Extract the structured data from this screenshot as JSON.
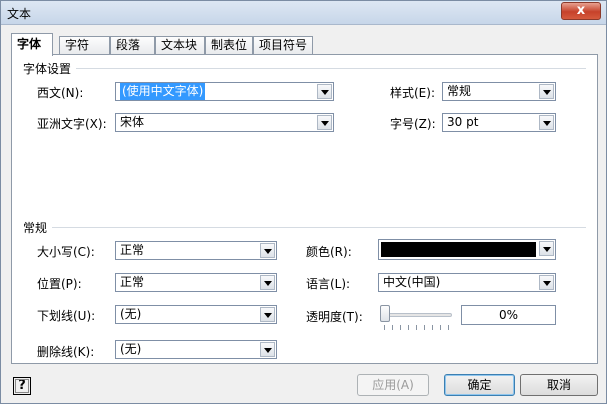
{
  "window": {
    "title": "文本",
    "close_glyph": "x"
  },
  "tabs": [
    {
      "label": "字体",
      "active": true
    },
    {
      "label": "字符"
    },
    {
      "label": "段落"
    },
    {
      "label": "文本块"
    },
    {
      "label": "制表位"
    },
    {
      "label": "项目符号"
    }
  ],
  "font_settings": {
    "group_title": "字体设置",
    "latin_label": "西文(N):",
    "latin_value": "(使用中文字体)",
    "asian_label": "亚洲文字(X):",
    "asian_value": "宋体",
    "style_label": "样式(E):",
    "style_value": "常规",
    "size_label": "字号(Z):",
    "size_value": "30 pt"
  },
  "general": {
    "group_title": "常规",
    "case_label": "大小写(C):",
    "case_value": "正常",
    "position_label": "位置(P):",
    "position_value": "正常",
    "underline_label": "下划线(U):",
    "underline_value": "(无)",
    "strikethrough_label": "删除线(K):",
    "strikethrough_value": "(无)",
    "color_label": "颜色(R):",
    "color_value": "#000000",
    "language_label": "语言(L):",
    "language_value": "中文(中国)",
    "transparency_label": "透明度(T):",
    "transparency_value": "0%",
    "transparency_level": 0
  },
  "buttons": {
    "help": "?",
    "apply": "应用(A)",
    "ok": "确定",
    "cancel": "取消"
  },
  "icons": {
    "close": "close-icon",
    "help": "help-icon",
    "dropdown": "chevron-down-icon"
  }
}
